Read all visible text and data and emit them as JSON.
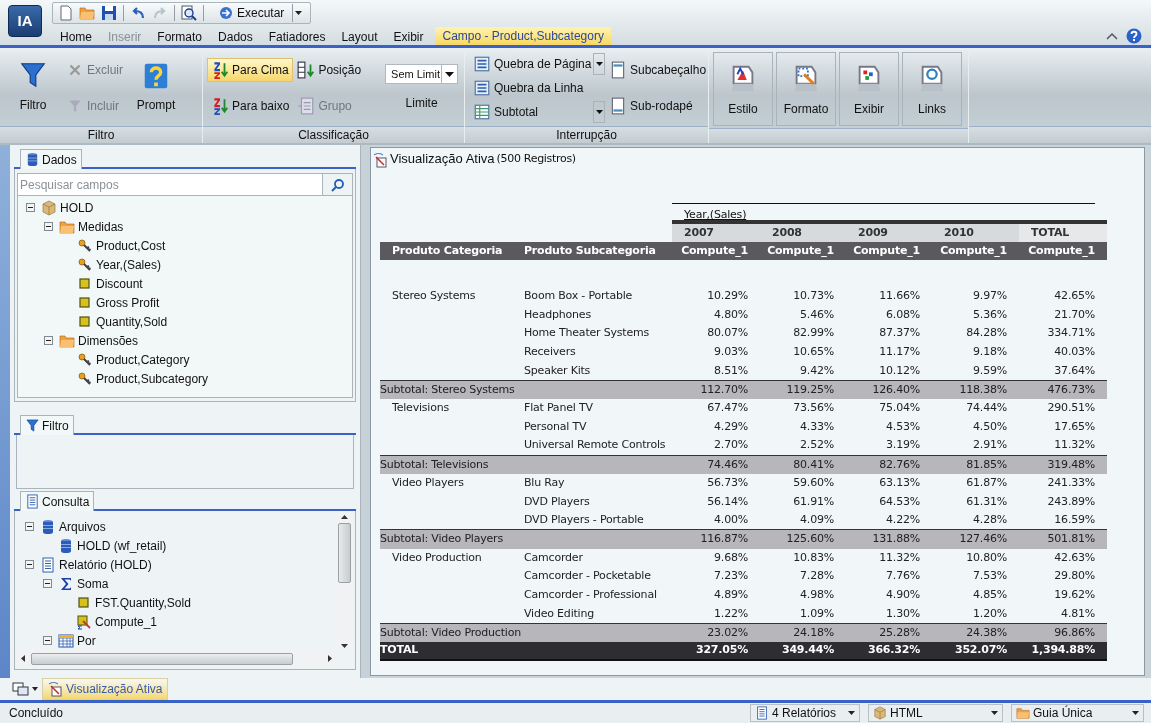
{
  "app": {
    "logo": "IA"
  },
  "quick_access": {
    "run_button": "Executar"
  },
  "menu_tabs": [
    {
      "label": "Home",
      "selected": false,
      "disabled": false
    },
    {
      "label": "Inserir",
      "selected": false,
      "disabled": true
    },
    {
      "label": "Formato",
      "selected": false,
      "disabled": false
    },
    {
      "label": "Dados",
      "selected": false,
      "disabled": false
    },
    {
      "label": "Fatiadores",
      "selected": false,
      "disabled": false
    },
    {
      "label": "Layout",
      "selected": false,
      "disabled": false
    },
    {
      "label": "Exibir",
      "selected": false,
      "disabled": false
    },
    {
      "label": "Campo - Product,Subcategory",
      "selected": true,
      "disabled": false
    }
  ],
  "ribbon": {
    "groups": [
      {
        "title": "Filtro",
        "columns": [
          [
            {
              "kind": "large",
              "label": "Filtro",
              "disabled": false,
              "selected": false
            }
          ],
          [
            {
              "kind": "small",
              "label": "Excluir",
              "disabled": true,
              "selected": false
            },
            {
              "kind": "small",
              "label": "Incluir",
              "disabled": true,
              "selected": false
            }
          ],
          [
            {
              "kind": "large",
              "label": "Prompt",
              "disabled": false,
              "selected": false
            }
          ]
        ]
      },
      {
        "title": "Classificação",
        "columns": [
          [
            {
              "kind": "small",
              "label": "Para Cima",
              "disabled": false,
              "selected": true
            },
            {
              "kind": "small",
              "label": "Para baixo",
              "disabled": false,
              "selected": false
            }
          ],
          [
            {
              "kind": "small",
              "label": "Posição",
              "disabled": false,
              "selected": false
            },
            {
              "kind": "small",
              "label": "Grupo",
              "disabled": true,
              "selected": false
            }
          ],
          [
            {
              "kind": "dropdown",
              "value": "Sem Limit",
              "label": "Limite",
              "disabled": false,
              "selected": false
            }
          ]
        ]
      },
      {
        "title": "Interrupção",
        "columns": [
          [
            {
              "kind": "split",
              "label": "Quebra de Página",
              "disabled": false,
              "selected": false
            },
            {
              "kind": "small",
              "label": "Quebra da Linha",
              "disabled": false,
              "selected": false
            },
            {
              "kind": "split",
              "label": "Subtotal",
              "disabled": false,
              "selected": false
            }
          ],
          [
            {
              "kind": "small",
              "label": "Subcabeçalho",
              "disabled": false,
              "selected": false
            },
            {
              "kind": "small",
              "label": "Sub-rodapé",
              "disabled": false,
              "selected": false
            }
          ]
        ]
      },
      {
        "columns": [
          [
            {
              "kind": "tile",
              "label": "Estilo",
              "disabled": false,
              "selected": false
            }
          ],
          [
            {
              "kind": "tile",
              "label": "Formato",
              "disabled": false,
              "selected": false
            }
          ],
          [
            {
              "kind": "tile",
              "label": "Exibir",
              "disabled": false,
              "selected": false
            }
          ],
          [
            {
              "kind": "tile",
              "label": "Links",
              "disabled": false,
              "selected": false
            }
          ]
        ]
      }
    ]
  },
  "data_panel": {
    "title": "Dados",
    "search": {
      "placeholder": "Pesquisar campos"
    },
    "tree": [
      {
        "kind": "source",
        "label": "HOLD",
        "expanded": true,
        "children": [
          {
            "kind": "folder",
            "label": "Medidas",
            "expanded": true,
            "children": [
              {
                "kind": "dimension",
                "label": "Product,Cost"
              },
              {
                "kind": "dimension",
                "label": "Year,(Sales)"
              },
              {
                "kind": "measure",
                "label": "Discount"
              },
              {
                "kind": "measure",
                "label": "Gross Profit"
              },
              {
                "kind": "measure",
                "label": "Quantity,Sold"
              }
            ]
          },
          {
            "kind": "folder",
            "label": "Dimensões",
            "expanded": true,
            "children": [
              {
                "kind": "dimension",
                "label": "Product,Category"
              },
              {
                "kind": "dimension",
                "label": "Product,Subcategory"
              }
            ]
          }
        ]
      }
    ]
  },
  "filter_panel": {
    "title": "Filtro"
  },
  "query_panel": {
    "title": "Consulta",
    "tree": [
      {
        "kind": "database",
        "label": "Arquivos",
        "expanded": true,
        "children": [
          {
            "kind": "database",
            "label": "HOLD (wf_retail)"
          }
        ]
      },
      {
        "kind": "document",
        "label": "Relatório (HOLD)",
        "expanded": true,
        "children": [
          {
            "kind": "sigma",
            "label": "Soma",
            "expanded": true,
            "children": [
              {
                "kind": "measure",
                "label": "FST.Quantity,Sold"
              },
              {
                "kind": "compute",
                "label": "Compute_1"
              }
            ]
          },
          {
            "kind": "grid",
            "label": "Por",
            "expanded": true
          }
        ]
      }
    ]
  },
  "report": {
    "title": "Visualização Ativa",
    "record_count": "(500 Registros)",
    "table": {
      "across_label": "Year,(Sales)",
      "years": [
        "2007",
        "2008",
        "2009",
        "2010",
        "TOTAL"
      ],
      "columns": [
        "Produto Categoria",
        "Produto Subcategoria",
        "Compute_1",
        "Compute_1",
        "Compute_1",
        "Compute_1",
        "Compute_1"
      ],
      "groups": [
        {
          "category": "Stereo Systems",
          "rows": [
            {
              "subcategory": "Boom Box - Portable",
              "values": [
                "10.29%",
                "10.73%",
                "11.66%",
                "9.97%",
                "42.65%"
              ]
            },
            {
              "subcategory": "Headphones",
              "values": [
                "4.80%",
                "5.46%",
                "6.08%",
                "5.36%",
                "21.70%"
              ]
            },
            {
              "subcategory": "Home Theater Systems",
              "values": [
                "80.07%",
                "82.99%",
                "87.37%",
                "84.28%",
                "334.71%"
              ]
            },
            {
              "subcategory": "Receivers",
              "values": [
                "9.03%",
                "10.65%",
                "11.17%",
                "9.18%",
                "40.03%"
              ]
            },
            {
              "subcategory": "Speaker Kits",
              "values": [
                "8.51%",
                "9.42%",
                "10.12%",
                "9.59%",
                "37.64%"
              ]
            }
          ],
          "subtotal": {
            "label": "Subtotal: Stereo Systems",
            "values": [
              "112.70%",
              "119.25%",
              "126.40%",
              "118.38%",
              "476.73%"
            ]
          }
        },
        {
          "category": "Televisions",
          "rows": [
            {
              "subcategory": "Flat Panel TV",
              "values": [
                "67.47%",
                "73.56%",
                "75.04%",
                "74.44%",
                "290.51%"
              ]
            },
            {
              "subcategory": "Personal TV",
              "values": [
                "4.29%",
                "4.33%",
                "4.53%",
                "4.50%",
                "17.65%"
              ]
            },
            {
              "subcategory": "Universal Remote Controls",
              "values": [
                "2.70%",
                "2.52%",
                "3.19%",
                "2.91%",
                "11.32%"
              ]
            }
          ],
          "subtotal": {
            "label": "Subtotal: Televisions",
            "values": [
              "74.46%",
              "80.41%",
              "82.76%",
              "81.85%",
              "319.48%"
            ]
          }
        },
        {
          "category": "Video Players",
          "rows": [
            {
              "subcategory": "Blu Ray",
              "values": [
                "56.73%",
                "59.60%",
                "63.13%",
                "61.87%",
                "241.33%"
              ]
            },
            {
              "subcategory": "DVD Players",
              "values": [
                "56.14%",
                "61.91%",
                "64.53%",
                "61.31%",
                "243.89%"
              ]
            },
            {
              "subcategory": "DVD Players - Portable",
              "values": [
                "4.00%",
                "4.09%",
                "4.22%",
                "4.28%",
                "16.59%"
              ]
            }
          ],
          "subtotal": {
            "label": "Subtotal: Video Players",
            "values": [
              "116.87%",
              "125.60%",
              "131.88%",
              "127.46%",
              "501.81%"
            ]
          }
        },
        {
          "category": "Video Production",
          "rows": [
            {
              "subcategory": "Camcorder",
              "values": [
                "9.68%",
                "10.83%",
                "11.32%",
                "10.80%",
                "42.63%"
              ]
            },
            {
              "subcategory": "Camcorder - Pocketable",
              "values": [
                "7.23%",
                "7.28%",
                "7.76%",
                "7.53%",
                "29.80%"
              ]
            },
            {
              "subcategory": "Camcorder - Professional",
              "values": [
                "4.89%",
                "4.98%",
                "4.90%",
                "4.85%",
                "19.62%"
              ]
            },
            {
              "subcategory": "Video Editing",
              "values": [
                "1.22%",
                "1.09%",
                "1.30%",
                "1.20%",
                "4.81%"
              ]
            }
          ],
          "subtotal": {
            "label": "Subtotal: Video Production",
            "values": [
              "23.02%",
              "24.18%",
              "25.28%",
              "24.38%",
              "96.86%"
            ]
          }
        }
      ],
      "total": {
        "label": "TOTAL",
        "values": [
          "327.05%",
          "349.44%",
          "366.32%",
          "352.07%",
          "1,394.88%"
        ]
      }
    }
  },
  "bottom_tabs": [
    {
      "label": "Visualização Ativa",
      "selected": true
    }
  ],
  "status_bar": {
    "message": "Concluído",
    "dropdowns": [
      "4 Relatórios",
      "HTML",
      "Guia Única"
    ]
  }
}
